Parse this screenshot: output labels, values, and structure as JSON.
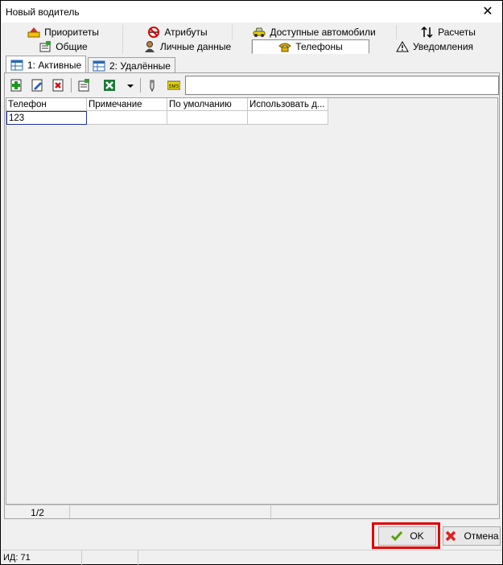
{
  "window": {
    "title": "Новый водитель",
    "close_glyph": "✕"
  },
  "tabs_row1": [
    {
      "label": "Приоритеты",
      "icon": "priority-icon"
    },
    {
      "label": "Атрибуты",
      "icon": "no-smoking-icon"
    },
    {
      "label": "Доступные автомобили",
      "icon": "car-icon"
    },
    {
      "label": "Расчеты",
      "icon": "arrows-updown-icon"
    }
  ],
  "tabs_row2": [
    {
      "label": "Общие",
      "icon": "properties-icon"
    },
    {
      "label": "Личные данные",
      "icon": "person-icon"
    },
    {
      "label": "Телефоны",
      "icon": "telephone-icon",
      "active": true
    },
    {
      "label": "Уведомления",
      "icon": "warning-icon"
    }
  ],
  "subtabs": [
    {
      "label": "1: Активные",
      "active": true
    },
    {
      "label": "2: Удалённые",
      "active": false
    }
  ],
  "toolbar": {
    "buttons": [
      "add-icon",
      "edit-icon",
      "delete-icon",
      "properties-icon",
      "excel-icon",
      "dropdown-arrow-icon",
      "pen-icon",
      "sms-icon"
    ],
    "search_value": ""
  },
  "grid": {
    "columns": [
      "Телефон",
      "Примечание",
      "По умолчанию",
      "Использовать д..."
    ],
    "rows": [
      [
        "123",
        "",
        "",
        ""
      ]
    ]
  },
  "status": {
    "pager": "1/2"
  },
  "buttons": {
    "ok": "OK",
    "cancel": "Отмена"
  },
  "bottom_status": {
    "id": "ИД: 71"
  },
  "colors": {
    "highlight": "#e00000",
    "focus": "#1c2fa8"
  }
}
